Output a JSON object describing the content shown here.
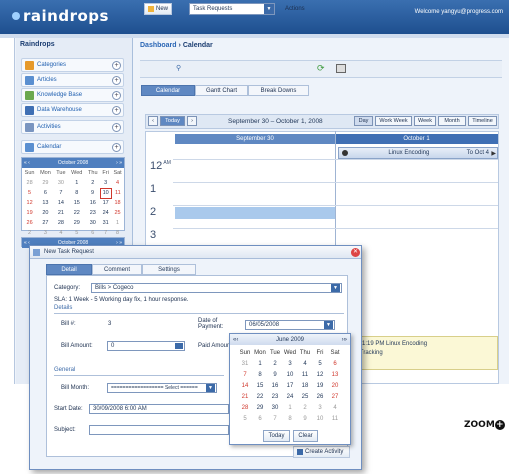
{
  "header": {
    "logo": "raindrops",
    "welcome": "Welcome yangyu@progress.com"
  },
  "left_pane": {
    "title": "Raindrops",
    "items": [
      {
        "label": "Categories",
        "icon": "categories-icon",
        "color": "#e69a2c"
      },
      {
        "label": "Articles",
        "icon": "articles-icon",
        "color": "#5a8fd0"
      },
      {
        "label": "Knowledge Base",
        "icon": "knowledge-base-icon",
        "color": "#6aa84f"
      },
      {
        "label": "Data Warehouse",
        "icon": "data-warehouse-icon",
        "color": "#3f6fb4"
      },
      {
        "label": "Activities",
        "icon": "activities-icon",
        "color": "#7a95c0"
      },
      {
        "label": "Calendar",
        "icon": "calendar-icon",
        "color": "#5a8fd0"
      }
    ],
    "mini_calendar": {
      "month": "October 2008",
      "weekdays": [
        "Sun",
        "Mon",
        "Tue",
        "Wed",
        "Thu",
        "Fri",
        "Sat"
      ],
      "weeks": [
        [
          "28",
          "29",
          "30",
          "1",
          "2",
          "3",
          "4"
        ],
        [
          "5",
          "6",
          "7",
          "8",
          "9",
          "10",
          "11"
        ],
        [
          "12",
          "13",
          "14",
          "15",
          "16",
          "17",
          "18"
        ],
        [
          "19",
          "20",
          "21",
          "22",
          "23",
          "24",
          "25"
        ],
        [
          "26",
          "27",
          "28",
          "29",
          "30",
          "31",
          "1"
        ],
        [
          "2",
          "3",
          "4",
          "5",
          "6",
          "7",
          "8"
        ]
      ]
    },
    "mini_calendar2_month": "October 2008"
  },
  "breadcrumb": {
    "root": "Dashboard",
    "sep": "›",
    "current": "Calendar"
  },
  "toolbar": {
    "new": "New",
    "type_select": "Task Requests",
    "actions": "Actions"
  },
  "view_tabs": [
    "Calendar",
    "Gantt Chart",
    "Break Downs"
  ],
  "calendar": {
    "today": "Today",
    "range": "September 30 – October 1, 2008",
    "views": [
      "Day",
      "Work Week",
      "Week",
      "Month",
      "Timeline"
    ],
    "columns": [
      "September 30",
      "October 1"
    ],
    "hours": [
      {
        "h": "12",
        "ap": "AM"
      },
      {
        "h": "1",
        "ap": ""
      },
      {
        "h": "2",
        "ap": ""
      },
      {
        "h": "3",
        "ap": ""
      }
    ],
    "event": {
      "title": "Linux Encoding",
      "to": "To Oct 4"
    },
    "yellow_line1": "M-1:19 PM Linux Encoding",
    "yellow_line2": "g Tracking"
  },
  "dialog": {
    "title": "New Task Request",
    "tabs": [
      "Detail",
      "Comment",
      "Settings"
    ],
    "category_label": "Category:",
    "category_value": "Bills > Cogeco",
    "sla": "SLA: 1 Week - 5 Working day fix, 1 hour response.",
    "details_section": "Details",
    "bill_no_label": "Bill #:",
    "bill_no_value": "3",
    "date_payment_label": "Date of Payment:",
    "date_payment_value": "06/05/2008",
    "bill_amount_label": "Bill Amount:",
    "bill_amount_value": "0",
    "paid_amount_label": "Paid Amoun",
    "general_section": "General",
    "bill_month_label": "Bill Month:",
    "bill_month_value": "================== Select ======",
    "start_date_label": "Start Date:",
    "start_date_value": "30/09/2008 6:00 AM",
    "subject_label": "Subject:",
    "create_button": "Create Activity"
  },
  "datepicker": {
    "month": "June 2009",
    "weekdays": [
      "Sun",
      "Mon",
      "Tue",
      "Wed",
      "Thu",
      "Fri",
      "Sat"
    ],
    "weeks": [
      [
        "31",
        "1",
        "2",
        "3",
        "4",
        "5",
        "6"
      ],
      [
        "7",
        "8",
        "9",
        "10",
        "11",
        "12",
        "13"
      ],
      [
        "14",
        "15",
        "16",
        "17",
        "18",
        "19",
        "20"
      ],
      [
        "21",
        "22",
        "23",
        "24",
        "25",
        "26",
        "27"
      ],
      [
        "28",
        "29",
        "30",
        "1",
        "2",
        "3",
        "4"
      ],
      [
        "5",
        "6",
        "7",
        "8",
        "9",
        "10",
        "11"
      ]
    ],
    "today": "Today",
    "clear": "Clear"
  },
  "watermark": "ZOOM"
}
